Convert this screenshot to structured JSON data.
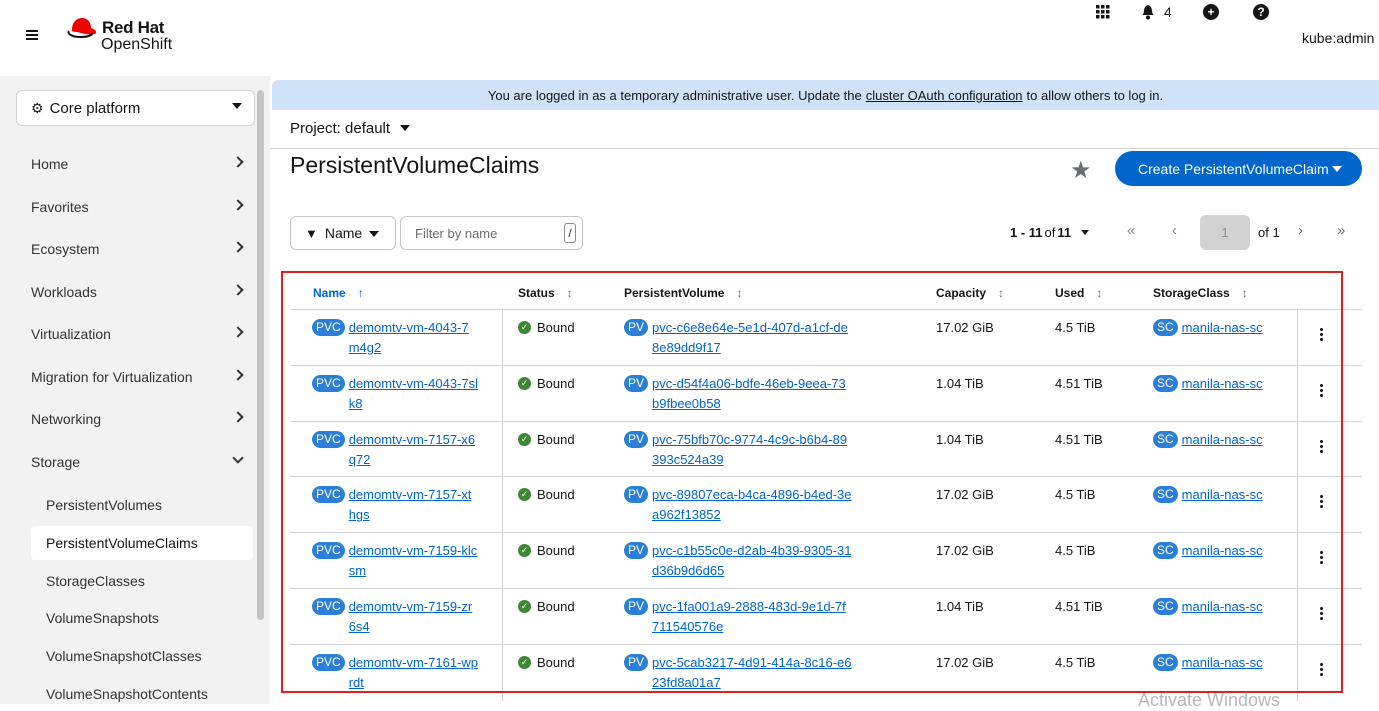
{
  "masthead": {
    "brand_line1": "Red Hat",
    "brand_line2": "OpenShift",
    "notifications_count": "4",
    "user": "kube:admin",
    "icons": [
      "menu-icon",
      "apps-grid-icon",
      "bell-icon",
      "plus-circle-icon",
      "help-icon"
    ]
  },
  "sidebar": {
    "perspective": "Core platform",
    "items": [
      {
        "label": "Home"
      },
      {
        "label": "Favorites"
      },
      {
        "label": "Ecosystem"
      },
      {
        "label": "Workloads"
      },
      {
        "label": "Virtualization"
      },
      {
        "label": "Migration for Virtualization"
      },
      {
        "label": "Networking"
      },
      {
        "label": "Storage"
      }
    ],
    "storage_items": [
      {
        "label": "PersistentVolumes"
      },
      {
        "label": "PersistentVolumeClaims"
      },
      {
        "label": "StorageClasses"
      },
      {
        "label": "VolumeSnapshots"
      },
      {
        "label": "VolumeSnapshotClasses"
      },
      {
        "label": "VolumeSnapshotContents"
      }
    ],
    "active": "PersistentVolumeClaims"
  },
  "banner": {
    "text_before": "You are logged in as a temporary administrative user. Update the",
    "link": "cluster OAuth configuration",
    "text_after": "to allow others to log in."
  },
  "project": {
    "label": "Project: default"
  },
  "page": {
    "title": "PersistentVolumeClaims",
    "create_button": "Create PersistentVolumeClaim"
  },
  "toolbar": {
    "filter_type": "Name",
    "filter_placeholder": "Filter by name",
    "filter_shortcut": "/",
    "range": "1 - 11",
    "of_label": "of",
    "total": "11",
    "current_page": "1",
    "of_pages": "of 1"
  },
  "table": {
    "columns": [
      "Name",
      "Status",
      "PersistentVolume",
      "Capacity",
      "Used",
      "StorageClass"
    ],
    "badges": {
      "pvc": "PVC",
      "pv": "PV",
      "sc": "SC"
    },
    "rows": [
      {
        "name": "demomtv-vm-4043-7m4g2",
        "status": "Bound",
        "pv": "pvc-c6e8e64e-5e1d-407d-a1cf-de8e89dd9f17",
        "capacity": "17.02 GiB",
        "used": "4.5 TiB",
        "sc": "manila-nas-sc"
      },
      {
        "name": "demomtv-vm-4043-7slk8",
        "status": "Bound",
        "pv": "pvc-d54f4a06-bdfe-46eb-9eea-73b9fbee0b58",
        "capacity": "1.04 TiB",
        "used": "4.51 TiB",
        "sc": "manila-nas-sc"
      },
      {
        "name": "demomtv-vm-7157-x6q72",
        "status": "Bound",
        "pv": "pvc-75bfb70c-9774-4c9c-b6b4-89393c524a39",
        "capacity": "1.04 TiB",
        "used": "4.51 TiB",
        "sc": "manila-nas-sc"
      },
      {
        "name": "demomtv-vm-7157-xthgs",
        "status": "Bound",
        "pv": "pvc-89807eca-b4ca-4896-b4ed-3ea962f13852",
        "capacity": "17.02 GiB",
        "used": "4.5 TiB",
        "sc": "manila-nas-sc"
      },
      {
        "name": "demomtv-vm-7159-klcsm",
        "status": "Bound",
        "pv": "pvc-c1b55c0e-d2ab-4b39-9305-31d36b9d6d65",
        "capacity": "17.02 GiB",
        "used": "4.5 TiB",
        "sc": "manila-nas-sc"
      },
      {
        "name": "demomtv-vm-7159-zr6s4",
        "status": "Bound",
        "pv": "pvc-1fa001a9-2888-483d-9e1d-7f711540576e",
        "capacity": "1.04 TiB",
        "used": "4.51 TiB",
        "sc": "manila-nas-sc"
      },
      {
        "name": "demomtv-vm-7161-wprdt",
        "status": "Bound",
        "pv": "pvc-5cab3217-4d91-414a-8c16-e623fd8a01a7",
        "capacity": "17.02 GiB",
        "used": "4.5 TiB",
        "sc": "manila-nas-sc"
      }
    ]
  },
  "watermark": "Activate Windows",
  "colors": {
    "accent": "#0066cc",
    "banner": "#cfe2f7",
    "highlight_frame": "#e02020",
    "status_ok": "#3e8635",
    "brand_red": "#ee0000"
  }
}
